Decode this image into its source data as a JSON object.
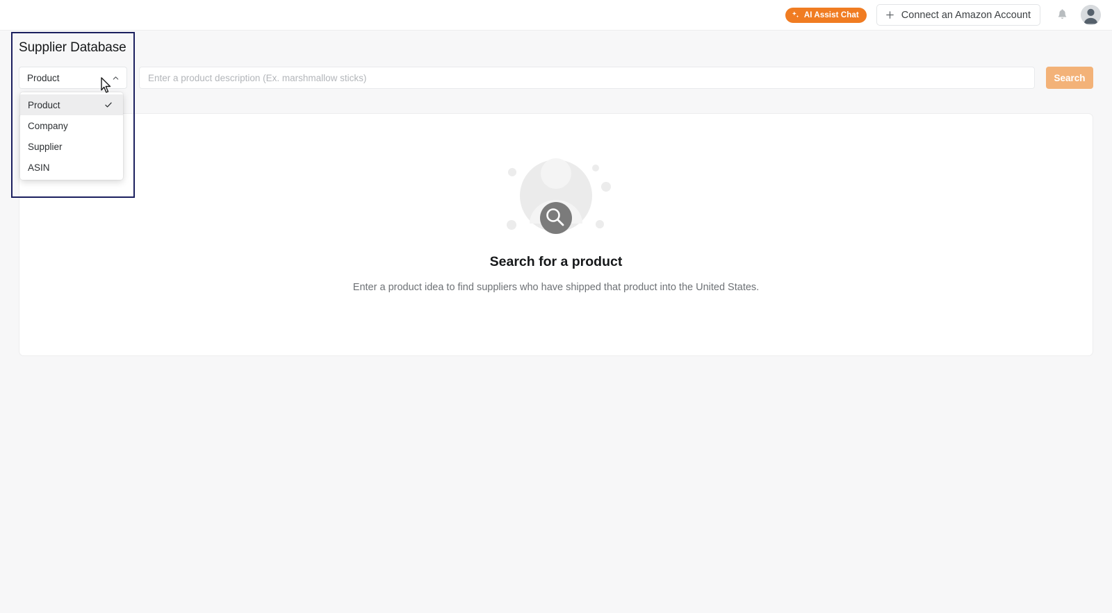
{
  "topbar": {
    "ai_chat_label": "AI Assist Chat",
    "ai_chat_icon": "sparkle-icon",
    "connect_label": "Connect an Amazon Account",
    "connect_icon": "plus-icon",
    "notifications_icon": "bell-icon",
    "avatar_icon": "user-avatar",
    "accent_orange": "#f07c22"
  },
  "page": {
    "title": "Supplier Database"
  },
  "search": {
    "type_selected": "Product",
    "type_chevron_icon": "chevron-up-icon",
    "placeholder": "Enter a product description (Ex. marshmallow sticks)",
    "value": "",
    "button_label": "Search",
    "button_color": "#f3b278"
  },
  "dropdown": {
    "open": true,
    "check_icon": "check-icon",
    "options": [
      {
        "label": "Product",
        "selected": true
      },
      {
        "label": "Company",
        "selected": false
      },
      {
        "label": "Supplier",
        "selected": false
      },
      {
        "label": "ASIN",
        "selected": false
      }
    ]
  },
  "empty_state": {
    "illustration_icon": "person-search-illustration",
    "title": "Search for a product",
    "subtitle": "Enter a product idea to find suppliers who have shipped that product into the United States."
  }
}
